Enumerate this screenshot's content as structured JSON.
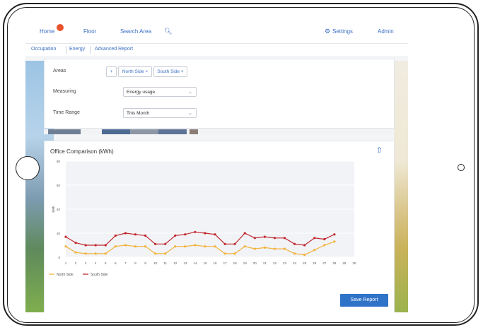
{
  "nav": {
    "home_label": "Home",
    "home_badge": "",
    "floor_label": "Floor",
    "search_label": "Search Area",
    "settings_label": "Settings",
    "admin_label": "Admin"
  },
  "subtabs": [
    "Occupation",
    "Energy",
    "Advanced Report"
  ],
  "filters": {
    "areas_label": "Areas",
    "add_chip": "+",
    "area_chips": [
      "North Side ×",
      "South Side ×"
    ],
    "measuring_label": "Measuring",
    "measuring_value": "Energy usage",
    "time_range_label": "Time Range",
    "time_range_value": "This Month"
  },
  "colors": {
    "accent": "#3b6fc4",
    "button": "#2f73c9",
    "north_series": "#f2b33d",
    "south_series": "#c1272d"
  },
  "chart_data": {
    "type": "line",
    "title": "Office Comparison (kWh)",
    "xlabel": "",
    "ylabel": "kWh",
    "ylim": [
      0,
      80
    ],
    "yticks": [
      0,
      20,
      40,
      60,
      80
    ],
    "x": [
      1,
      2,
      3,
      4,
      5,
      6,
      7,
      8,
      9,
      10,
      11,
      12,
      13,
      14,
      15,
      16,
      17,
      18,
      19,
      20,
      21,
      22,
      23,
      24,
      25,
      26,
      27,
      28,
      29,
      30
    ],
    "series": [
      {
        "name": "North Side",
        "color": "#f2b33d",
        "values": [
          9,
          4,
          3,
          3,
          3,
          9,
          10,
          9,
          9,
          3,
          3,
          9,
          9,
          10,
          9,
          9,
          3,
          3,
          9,
          7,
          8,
          7,
          7,
          3,
          2,
          6,
          10,
          13
        ]
      },
      {
        "name": "South Side",
        "color": "#c1272d",
        "values": [
          17,
          12,
          10,
          10,
          10,
          18,
          20,
          19,
          18,
          11,
          11,
          18,
          19,
          21,
          20,
          19,
          11,
          11,
          20,
          16,
          17,
          16,
          16,
          11,
          10,
          16,
          15,
          19
        ]
      }
    ],
    "legend_position": "bottom-left",
    "grid": true
  },
  "actions": {
    "save_report_label": "Save Report"
  }
}
